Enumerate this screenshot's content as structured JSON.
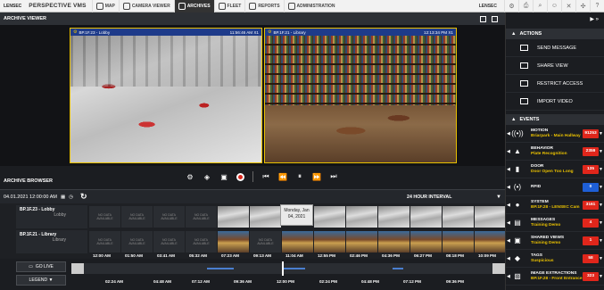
{
  "topnav": {
    "brand": "LENSEC",
    "app_name": "PERSPECTIVE VMS",
    "items": [
      {
        "label": "MAP",
        "active": false
      },
      {
        "label": "CAMERA VIEWER",
        "active": false
      },
      {
        "label": "ARCHIVES",
        "active": true
      },
      {
        "label": "FLEET",
        "active": false
      },
      {
        "label": "REPORTS",
        "active": false
      },
      {
        "label": "ADMINISTRATION",
        "active": false
      }
    ],
    "user": "LENSEC"
  },
  "viewer": {
    "title": "ARCHIVE VIEWER",
    "cameras": [
      {
        "name": "BP.1F.23 - Lobby",
        "time": "11:56:46 AM X1"
      },
      {
        "name": "BP.1F.21 - Library",
        "time": "12:13:34 PM X1"
      }
    ]
  },
  "browser": {
    "title": "ARCHIVE BROWSER",
    "date": "04.01.2021 12:00:00 AM",
    "interval": "24 HOUR INTERVAL",
    "rows": [
      {
        "name": "BP.1F.23 - Lobby",
        "sub": "Lobby"
      },
      {
        "name": "BP.1F.21 - Library",
        "sub": "Library"
      }
    ],
    "no_image": "NO DATA\nAVAILABLE",
    "tooltip": "Monday, Jan\n04, 2021",
    "timestamps": [
      "12:00 AM",
      "01:50 AM",
      "03:41 AM",
      "05:32 AM",
      "07:23 AM",
      "09:13 AM",
      "11:04 AM",
      "12:55 PM",
      "02:46 PM",
      "04:36 PM",
      "06:27 PM",
      "08:18 PM",
      "10:09 PM"
    ],
    "go_live": "GO LIVE",
    "legend": "LEGEND ▼",
    "scrub_times": [
      "02:24 AM",
      "04:48 AM",
      "07:12 AM",
      "09:36 AM",
      "12:00 PM",
      "02:24 PM",
      "04:48 PM",
      "07:12 PM",
      "09:36 PM"
    ]
  },
  "actions": {
    "title": "ACTIONS",
    "items": [
      "SEND MESSAGE",
      "SHARE VIEW",
      "RESTRICT ACCESS",
      "IMPORT VIDEO"
    ]
  },
  "events": {
    "title": "EVENTS",
    "items": [
      {
        "name": "MOTION",
        "detail": "Briarpark - Main Hallway",
        "count": "91253",
        "color": "#e0261b",
        "icon": "motion-icon"
      },
      {
        "name": "BEHAVIOR",
        "detail": "Plate Recognition",
        "count": "2359",
        "color": "#e0261b",
        "icon": "warning-icon"
      },
      {
        "name": "DOOR",
        "detail": "Door Open Too Long",
        "count": "135",
        "color": "#e0261b",
        "icon": "door-icon"
      },
      {
        "name": "RFID",
        "detail": "",
        "count": "0",
        "color": "#1e5fd6",
        "icon": "rfid-icon"
      },
      {
        "name": "SYSTEM",
        "detail": "BP.1F.28 - LENSEC Cam",
        "count": "3161",
        "color": "#e0261b",
        "icon": "system-icon"
      },
      {
        "name": "MESSAGES",
        "detail": "Training Demo",
        "count": "4",
        "color": "#e0261b",
        "icon": "message-icon"
      },
      {
        "name": "SHARED VIEWS",
        "detail": "Training Demo",
        "count": "1",
        "color": "#e0261b",
        "icon": "shared-view-icon"
      },
      {
        "name": "TAGS",
        "detail": "Suspicious",
        "count": "58",
        "color": "#e0261b",
        "icon": "tag-icon"
      },
      {
        "name": "IMAGE EXTRACTIONS",
        "detail": "BP.1F.28 - Front Entrance",
        "count": "323",
        "color": "#e0261b",
        "icon": "image-extraction-icon"
      }
    ]
  }
}
